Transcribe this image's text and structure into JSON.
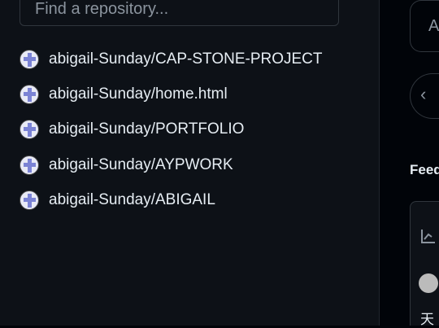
{
  "search": {
    "placeholder": "Find a repository..."
  },
  "repos": [
    {
      "owner": "abigail-Sunday",
      "name": "CAP-STONE-PROJECT"
    },
    {
      "owner": "abigail-Sunday",
      "name": "home.html"
    },
    {
      "owner": "abigail-Sunday",
      "name": "PORTFOLIO"
    },
    {
      "owner": "abigail-Sunday",
      "name": "AYPWORK"
    },
    {
      "owner": "abigail-Sunday",
      "name": "ABIGAIL"
    }
  ],
  "right": {
    "button_partial": "A",
    "back_icon": "‹",
    "feed_title": "Feed",
    "card_text_partial": "天"
  }
}
